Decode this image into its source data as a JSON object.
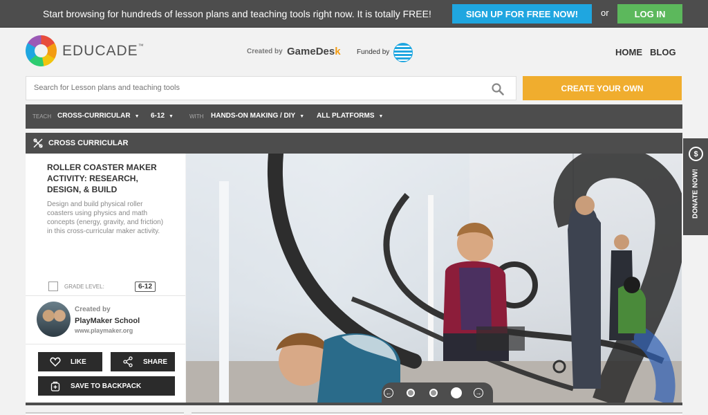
{
  "promo": {
    "text": "Start browsing for hundreds of lesson plans and teaching tools right now. It is totally FREE!",
    "signup_label": "SIGN UP FOR FREE NOW!",
    "or_text": "or",
    "login_label": "LOG IN"
  },
  "header": {
    "logo_text": "EDUCADE",
    "logo_tm": "™",
    "created_by": "Created by",
    "gamedesk": "GameDes",
    "gamedesk_k": "k",
    "funded_by": "Funded by",
    "nav": {
      "home": "HOME",
      "blog": "BLOG"
    }
  },
  "search": {
    "placeholder": "Search for Lesson plans and teaching tools",
    "create_label": "CREATE YOUR OWN"
  },
  "filters": {
    "teach_label": "TEACH",
    "subject": "CROSS-CURRICULAR",
    "grade": "6-12",
    "with_label": "WITH",
    "method": "HANDS-ON MAKING / DIY",
    "platform": "ALL PLATFORMS"
  },
  "category": {
    "title": "CROSS CURRICULAR"
  },
  "card": {
    "title": "ROLLER COASTER MAKER ACTIVITY: RESEARCH, DESIGN, & BUILD",
    "description": "Design and build physical roller coasters using physics and math concepts (energy, gravity, and friction) in this cross-curricular maker activity.",
    "grade_label": "GRADE LEVEL:",
    "grade_value": "6-12",
    "created_label": "Created by",
    "creator_name": "PlayMaker School",
    "creator_url": "www.playmaker.org",
    "like_label": "LIKE",
    "share_label": "SHARE",
    "backpack_label": "SAVE TO BACKPACK"
  },
  "carousel": {
    "slide_count": 3,
    "active_slide": 3
  },
  "donate": {
    "label": "DONATE NOW!",
    "icon_text": "$"
  },
  "icons": [
    "search-icon",
    "cross-curricular-icon",
    "grade-icon",
    "heart-icon",
    "share-icon",
    "backpack-icon",
    "arrow-left-icon",
    "arrow-right-icon",
    "donate-icon",
    "caret-down-icon"
  ],
  "colors": {
    "signup": "#1fa6e0",
    "login": "#5cb85c",
    "create": "#f0ad2e",
    "dark_bar": "#4d4d4d"
  }
}
